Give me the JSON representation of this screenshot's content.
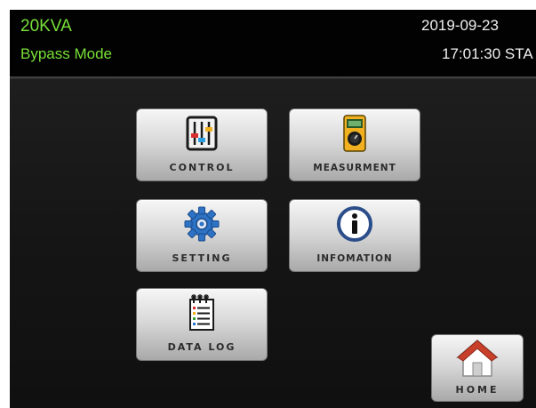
{
  "status": {
    "model": "20KVA",
    "mode": "Bypass Mode",
    "date": "2019-09-23",
    "time": "17:01:30 STA"
  },
  "menu": {
    "control": {
      "label": "CONTROL",
      "icon": "sliders-icon"
    },
    "measurement": {
      "label": "MEASURMENT",
      "icon": "multimeter-icon"
    },
    "setting": {
      "label": "SETTING",
      "icon": "gear-icon"
    },
    "information": {
      "label": "INFOMATION",
      "icon": "info-icon"
    },
    "datalog": {
      "label": "DATA LOG",
      "icon": "notepad-icon"
    }
  },
  "home": {
    "label": "HOME",
    "icon": "home-icon"
  },
  "colors": {
    "status_text": "#78e038",
    "clock_text": "#f0f0f0",
    "background": "#000000",
    "button_face": "#d9d9d9"
  }
}
